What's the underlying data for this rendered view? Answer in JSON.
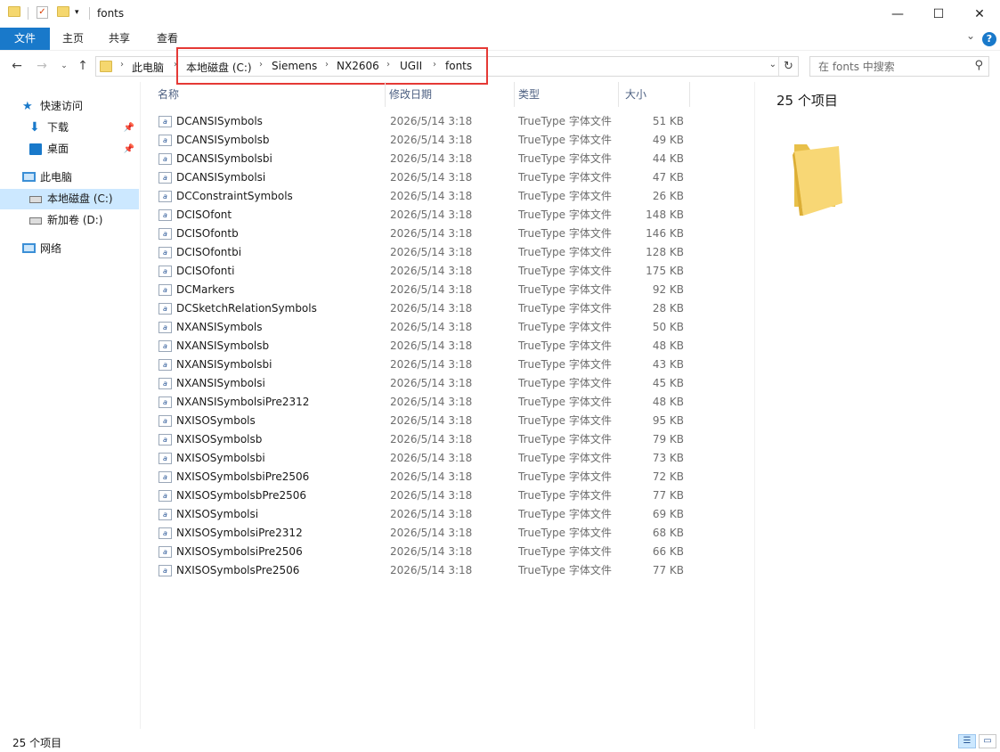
{
  "window": {
    "title": "fonts",
    "minimize": "—",
    "maximize": "☐",
    "close": "✕"
  },
  "ribbon": {
    "tabs": [
      "文件",
      "主页",
      "共享",
      "查看"
    ],
    "collapse": "⌄",
    "help": "?"
  },
  "address": {
    "breadcrumb": [
      "此电脑",
      "本地磁盘 (C:)",
      "Siemens",
      "NX2606",
      "UGII",
      "fonts"
    ],
    "separator": "›",
    "dropdown": "⌄",
    "refresh": "↻"
  },
  "search": {
    "placeholder": "在 fonts 中搜索",
    "icon": "⚲"
  },
  "nav_pane": {
    "quick_access": "快速访问",
    "downloads": "下载",
    "desktop": "桌面",
    "this_pc": "此电脑",
    "local_disk": "本地磁盘 (C:)",
    "new_volume": "新加卷 (D:)",
    "network": "网络",
    "pin": "📌"
  },
  "columns": {
    "name": "名称",
    "date": "修改日期",
    "type": "类型",
    "size": "大小"
  },
  "files": [
    {
      "name": "DCANSISymbols",
      "date": "2026/5/14 3:18",
      "type": "TrueType 字体文件",
      "size": "51 KB"
    },
    {
      "name": "DCANSISymbolsb",
      "date": "2026/5/14 3:18",
      "type": "TrueType 字体文件",
      "size": "49 KB"
    },
    {
      "name": "DCANSISymbolsbi",
      "date": "2026/5/14 3:18",
      "type": "TrueType 字体文件",
      "size": "44 KB"
    },
    {
      "name": "DCANSISymbolsi",
      "date": "2026/5/14 3:18",
      "type": "TrueType 字体文件",
      "size": "47 KB"
    },
    {
      "name": "DCConstraintSymbols",
      "date": "2026/5/14 3:18",
      "type": "TrueType 字体文件",
      "size": "26 KB"
    },
    {
      "name": "DCISOfont",
      "date": "2026/5/14 3:18",
      "type": "TrueType 字体文件",
      "size": "148 KB"
    },
    {
      "name": "DCISOfontb",
      "date": "2026/5/14 3:18",
      "type": "TrueType 字体文件",
      "size": "146 KB"
    },
    {
      "name": "DCISOfontbi",
      "date": "2026/5/14 3:18",
      "type": "TrueType 字体文件",
      "size": "128 KB"
    },
    {
      "name": "DCISOfonti",
      "date": "2026/5/14 3:18",
      "type": "TrueType 字体文件",
      "size": "175 KB"
    },
    {
      "name": "DCMarkers",
      "date": "2026/5/14 3:18",
      "type": "TrueType 字体文件",
      "size": "92 KB"
    },
    {
      "name": "DCSketchRelationSymbols",
      "date": "2026/5/14 3:18",
      "type": "TrueType 字体文件",
      "size": "28 KB"
    },
    {
      "name": "NXANSISymbols",
      "date": "2026/5/14 3:18",
      "type": "TrueType 字体文件",
      "size": "50 KB"
    },
    {
      "name": "NXANSISymbolsb",
      "date": "2026/5/14 3:18",
      "type": "TrueType 字体文件",
      "size": "48 KB"
    },
    {
      "name": "NXANSISymbolsbi",
      "date": "2026/5/14 3:18",
      "type": "TrueType 字体文件",
      "size": "43 KB"
    },
    {
      "name": "NXANSISymbolsi",
      "date": "2026/5/14 3:18",
      "type": "TrueType 字体文件",
      "size": "45 KB"
    },
    {
      "name": "NXANSISymbolsiPre2312",
      "date": "2026/5/14 3:18",
      "type": "TrueType 字体文件",
      "size": "48 KB"
    },
    {
      "name": "NXISOSymbols",
      "date": "2026/5/14 3:18",
      "type": "TrueType 字体文件",
      "size": "95 KB"
    },
    {
      "name": "NXISOSymbolsb",
      "date": "2026/5/14 3:18",
      "type": "TrueType 字体文件",
      "size": "79 KB"
    },
    {
      "name": "NXISOSymbolsbi",
      "date": "2026/5/14 3:18",
      "type": "TrueType 字体文件",
      "size": "73 KB"
    },
    {
      "name": "NXISOSymbolsbiPre2506",
      "date": "2026/5/14 3:18",
      "type": "TrueType 字体文件",
      "size": "72 KB"
    },
    {
      "name": "NXISOSymbolsbPre2506",
      "date": "2026/5/14 3:18",
      "type": "TrueType 字体文件",
      "size": "77 KB"
    },
    {
      "name": "NXISOSymbolsi",
      "date": "2026/5/14 3:18",
      "type": "TrueType 字体文件",
      "size": "69 KB"
    },
    {
      "name": "NXISOSymbolsiPre2312",
      "date": "2026/5/14 3:18",
      "type": "TrueType 字体文件",
      "size": "68 KB"
    },
    {
      "name": "NXISOSymbolsiPre2506",
      "date": "2026/5/14 3:18",
      "type": "TrueType 字体文件",
      "size": "66 KB"
    },
    {
      "name": "NXISOSymbolsPre2506",
      "date": "2026/5/14 3:18",
      "type": "TrueType 字体文件",
      "size": "77 KB"
    }
  ],
  "file_icon_glyph": "a",
  "preview": {
    "count": "25 个项目"
  },
  "status": {
    "count": "25 个项目"
  },
  "colors": {
    "accent": "#1979ca",
    "selection": "#cce8ff",
    "highlight_box": "#e53935",
    "folder": "#f5d76e"
  }
}
